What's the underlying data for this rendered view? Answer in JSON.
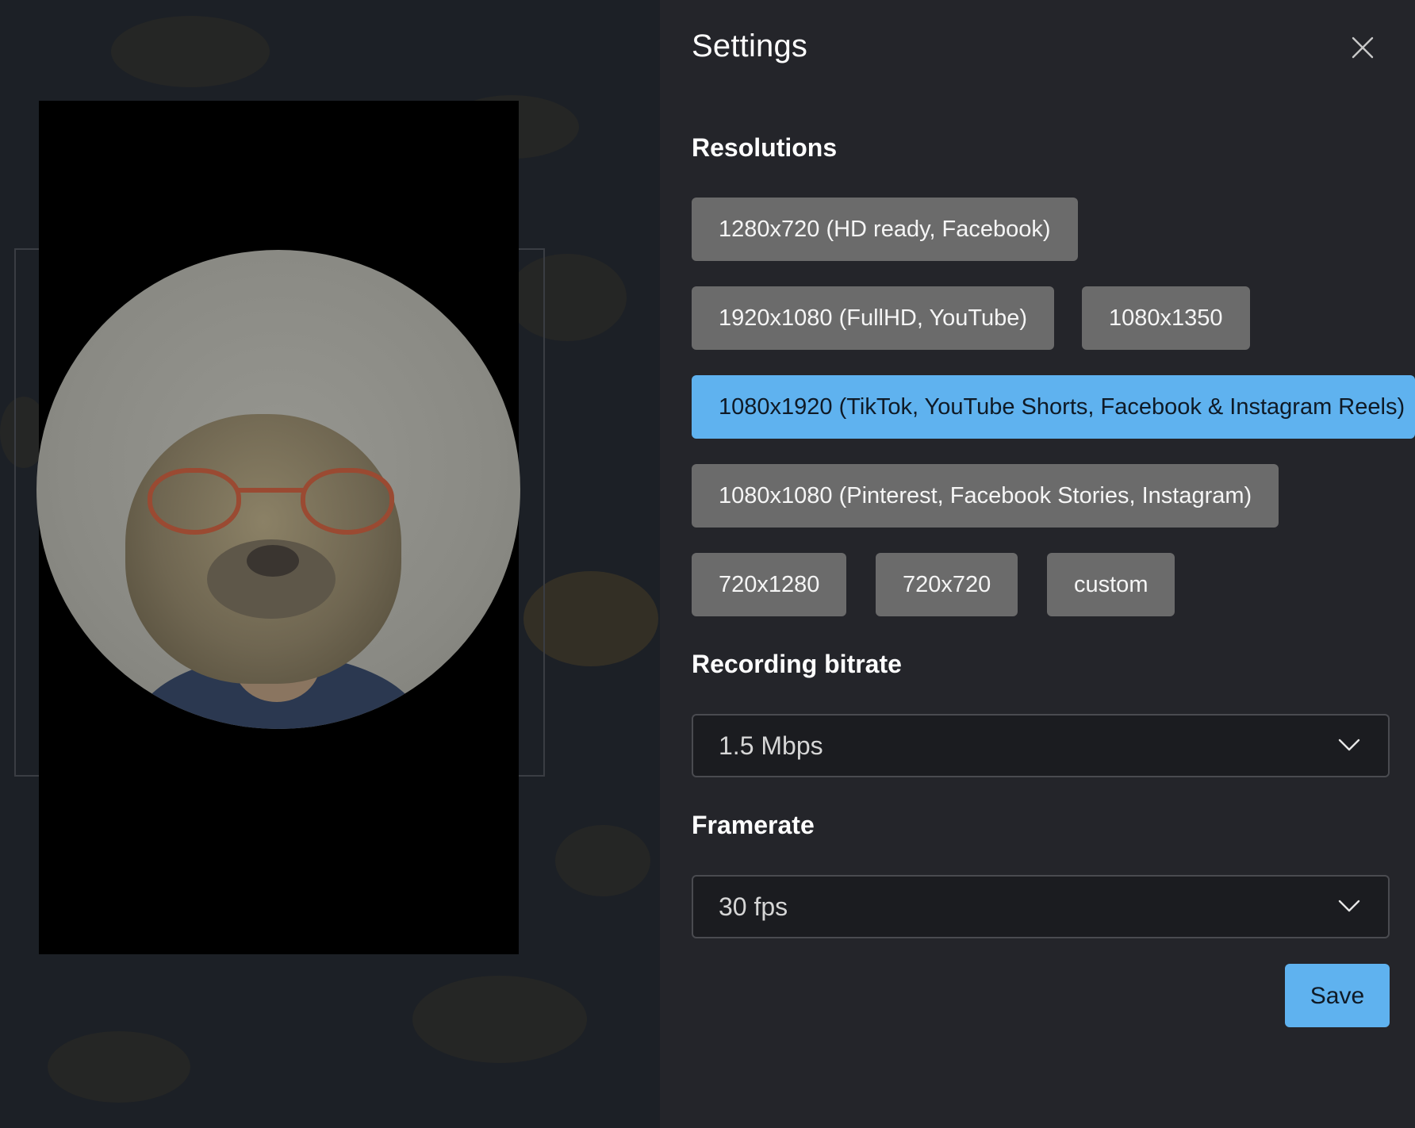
{
  "settings": {
    "title": "Settings",
    "close_icon": "close-icon"
  },
  "resolutions": {
    "heading": "Resolutions",
    "selected": "1080x1920 (TikTok, YouTube Shorts, Facebook & Instagram Reels)",
    "options": [
      "1280x720 (HD ready, Facebook)",
      "1920x1080 (FullHD, YouTube)",
      "1080x1350",
      "1080x1920 (TikTok, YouTube Shorts, Facebook & Instagram Reels)",
      "1080x1080 (Pinterest, Facebook Stories, Instagram)",
      "720x1280",
      "720x720",
      "custom"
    ]
  },
  "bitrate": {
    "heading": "Recording bitrate",
    "value": "1.5 Mbps"
  },
  "framerate": {
    "heading": "Framerate",
    "value": "30 fps"
  },
  "actions": {
    "save_label": "Save"
  },
  "colors": {
    "panel_bg": "#24252a",
    "button_bg": "#6b6b6b",
    "accent": "#5fb2ef"
  }
}
